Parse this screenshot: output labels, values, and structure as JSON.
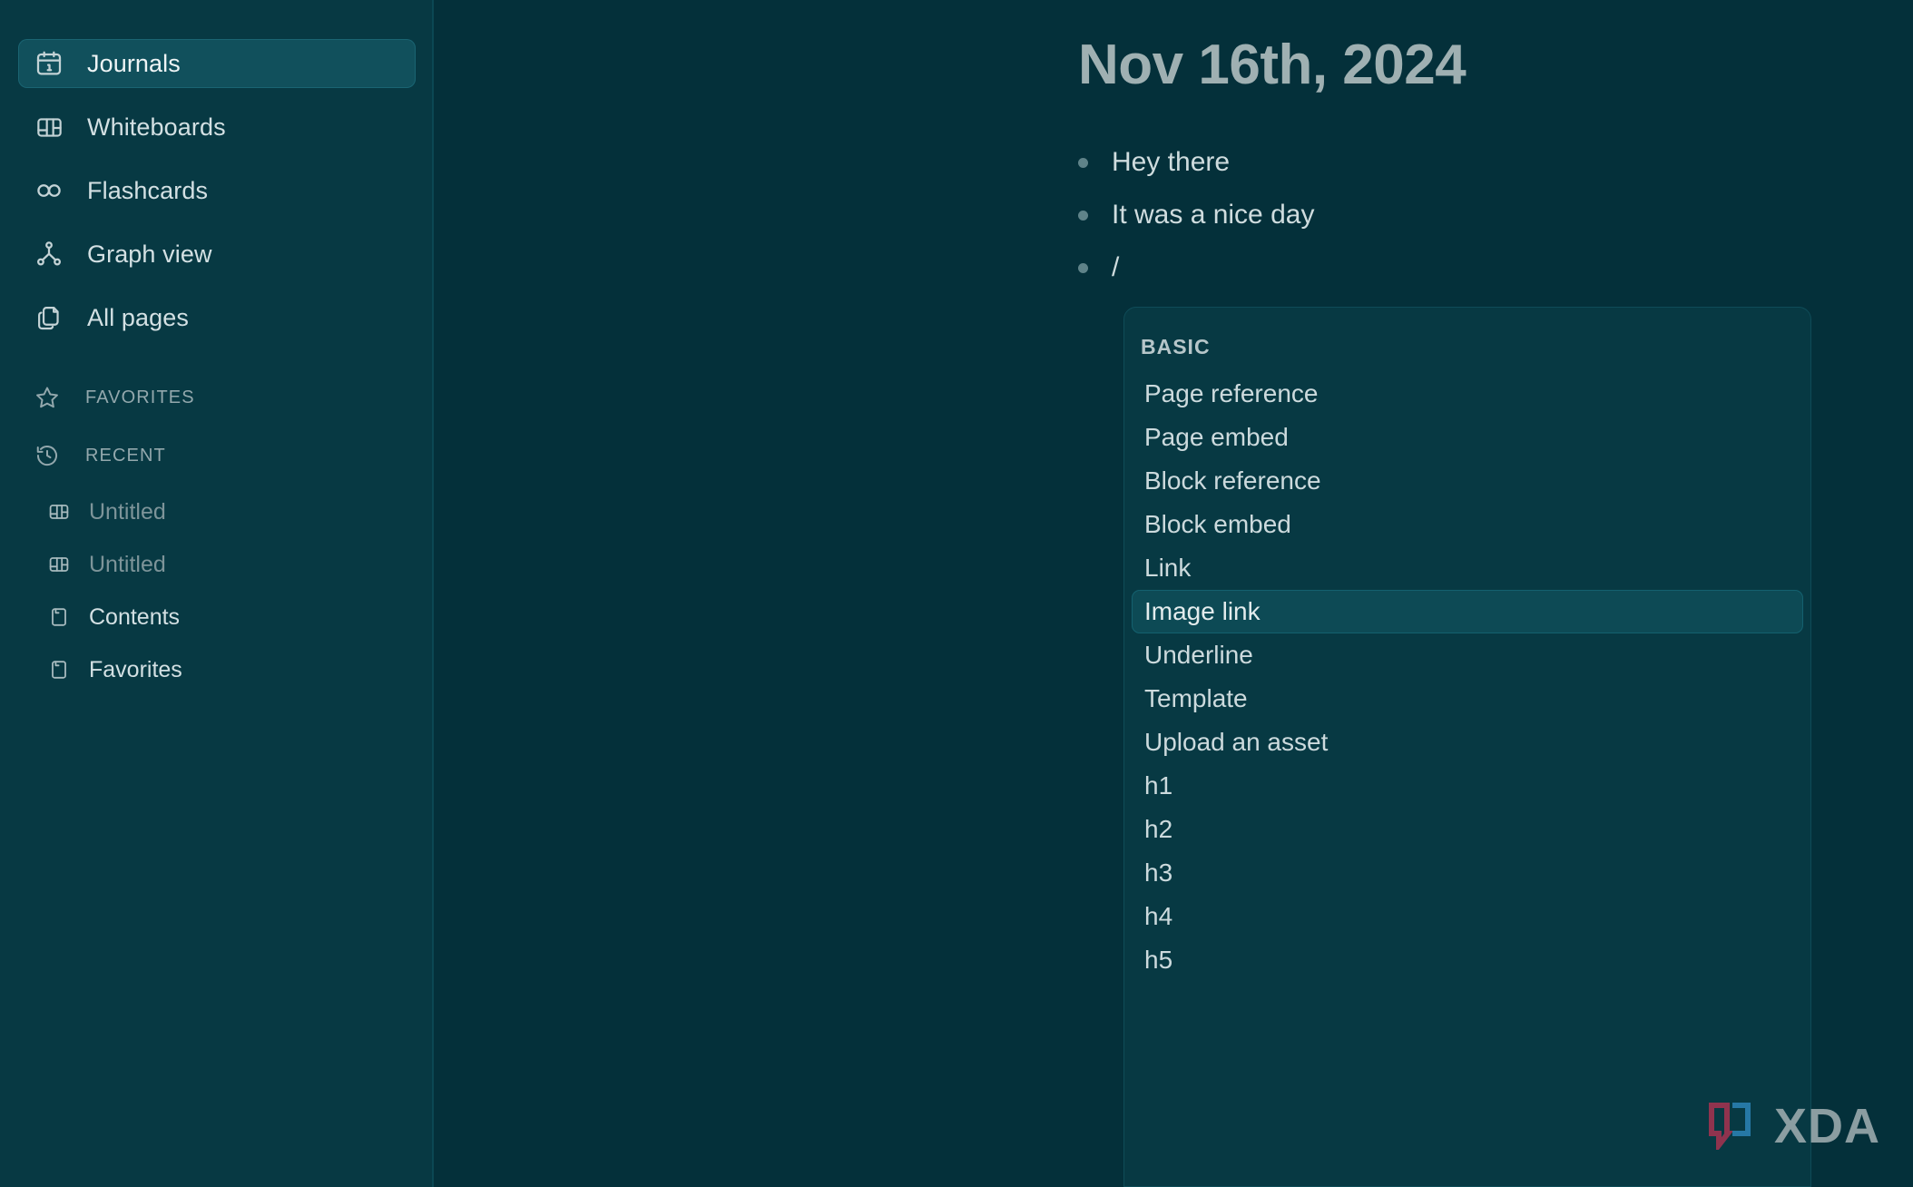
{
  "app": {
    "name": "Logseq",
    "sidebar_top_sliver": "",
    "theme": {
      "sidebar_bg": "#073943",
      "main_bg": "#04303a",
      "accent_active": "#11505c",
      "text_primary": "#d3e0e3",
      "text_muted": "#93a8ad"
    }
  },
  "sidebar": {
    "nav": [
      {
        "label": "Journals",
        "icon": "calendar-icon",
        "active": true
      },
      {
        "label": "Whiteboards",
        "icon": "whiteboard-icon",
        "active": false
      },
      {
        "label": "Flashcards",
        "icon": "infinity-icon",
        "active": false
      },
      {
        "label": "Graph view",
        "icon": "graph-icon",
        "active": false
      },
      {
        "label": "All pages",
        "icon": "pages-icon",
        "active": false
      }
    ],
    "sections": [
      {
        "label": "FAVORITES",
        "icon": "star-icon"
      },
      {
        "label": "RECENT",
        "icon": "history-icon"
      }
    ],
    "recent": [
      {
        "label": "Untitled",
        "icon": "whiteboard-icon",
        "muted": true
      },
      {
        "label": "Untitled",
        "icon": "whiteboard-icon",
        "muted": true
      },
      {
        "label": "Contents",
        "icon": "page-icon",
        "muted": false
      },
      {
        "label": "Favorites",
        "icon": "page-icon",
        "muted": false
      }
    ]
  },
  "main": {
    "page_title": "Nov 16th, 2024",
    "blocks": [
      {
        "text": "Hey there"
      },
      {
        "text": "It was a nice day"
      },
      {
        "text": "/"
      }
    ]
  },
  "slash_menu": {
    "group_title": "BASIC",
    "items": [
      {
        "label": "Page reference",
        "selected": false
      },
      {
        "label": "Page embed",
        "selected": false
      },
      {
        "label": "Block reference",
        "selected": false
      },
      {
        "label": "Block embed",
        "selected": false
      },
      {
        "label": "Link",
        "selected": false
      },
      {
        "label": "Image link",
        "selected": true
      },
      {
        "label": "Underline",
        "selected": false
      },
      {
        "label": "Template",
        "selected": false
      },
      {
        "label": "Upload an asset",
        "selected": false
      },
      {
        "label": "h1",
        "selected": false
      },
      {
        "label": "h2",
        "selected": false
      },
      {
        "label": "h3",
        "selected": false
      },
      {
        "label": "h4",
        "selected": false
      },
      {
        "label": "h5",
        "selected": false
      }
    ]
  },
  "watermark": {
    "text": "XDA",
    "bracket_left_color": "#9e3350",
    "bracket_right_color": "#2a7fb0",
    "text_color": "#9aa9ad"
  }
}
